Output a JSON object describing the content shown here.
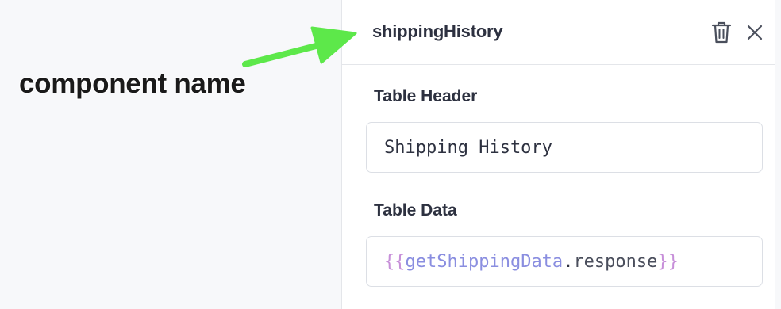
{
  "panel": {
    "component_name": "shippingHistory",
    "icons": {
      "delete": "trash-icon",
      "close": "close-icon"
    }
  },
  "fields": {
    "table_header": {
      "label": "Table Header",
      "value": "Shipping History"
    },
    "table_data": {
      "label": "Table Data",
      "open_braces": "{{",
      "variable": "getShippingData",
      "dot": ".",
      "property": "response",
      "close_braces": "}}"
    }
  },
  "annotation": {
    "text": "component name",
    "arrow_color": "#5de84a"
  },
  "colors": {
    "brace": "#c78fd9",
    "variable": "#8a8ee0",
    "text": "#2d3140",
    "border": "#dcdfe5"
  }
}
